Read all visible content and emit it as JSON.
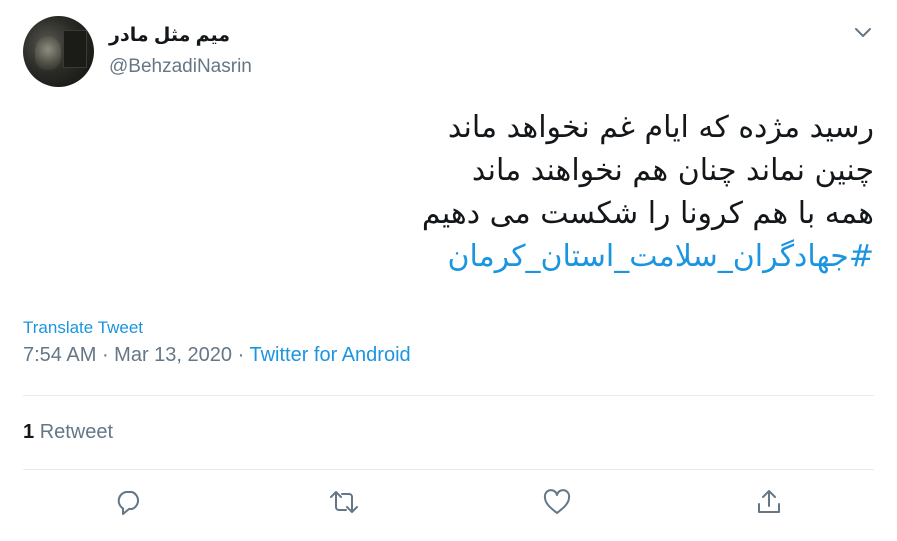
{
  "author": {
    "display_name": "میم مثل مادر",
    "handle": "@BehzadiNasrin"
  },
  "tweet": {
    "lines": [
      "رسید مژده که ایام غم نخواهد ماند",
      "چنین نماند چنان هم نخواهند ماند",
      "همه با هم کرونا را شکست می دهیم"
    ],
    "hashtag": "#جهادگران_سلامت_استان_کرمان"
  },
  "translate_label": "Translate Tweet",
  "meta": {
    "time": "7:54 AM",
    "separator": " · ",
    "date": "Mar 13, 2020",
    "source": "Twitter for Android"
  },
  "stats": {
    "retweet_count": "1",
    "retweet_label": "Retweet"
  },
  "actions": {
    "reply_icon": "reply-icon",
    "retweet_icon": "retweet-icon",
    "like_icon": "like-icon",
    "share_icon": "share-icon"
  },
  "colors": {
    "link": "#1b95e0",
    "secondary_text": "#657786",
    "primary_text": "#14171a",
    "divider": "#e6ecf0"
  }
}
